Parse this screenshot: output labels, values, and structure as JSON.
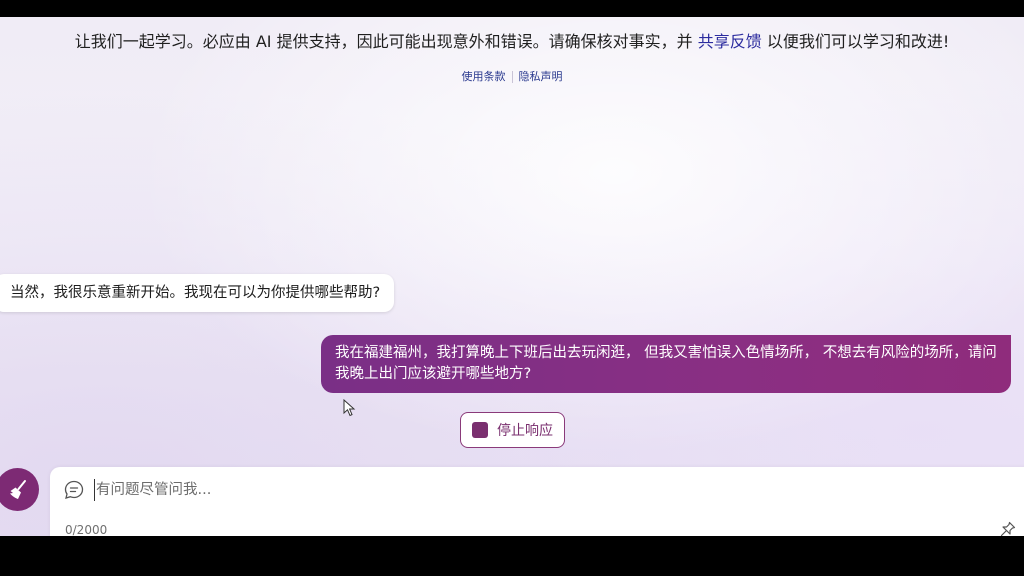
{
  "disclaimer": {
    "text_before": "让我们一起学习。必应由 AI 提供支持，因此可能出现意外和错误。请确保核对事实，并",
    "feedback_link": "共享反馈",
    "text_after": "以便我们可以学习和改进!"
  },
  "legal_links": {
    "terms": "使用条款",
    "privacy": "隐私声明"
  },
  "conversation": {
    "bot_message": "当然，我很乐意重新开始。我现在可以为你提供哪些帮助?",
    "user_message": "我在福建福州，我打算晚上下班后出去玩闲逛， 但我又害怕误入色情场所， 不想去有风险的场所，请问我晚上出门应该避开哪些地方?"
  },
  "stop_button": {
    "label": "停止响应"
  },
  "composer": {
    "placeholder": "有问题尽管问我...",
    "char_count": "0/2000"
  },
  "icons": {
    "new_topic": "broom-icon",
    "chat": "chat-bubble-icon",
    "pin": "pin-icon",
    "stop": "stop-square-icon"
  },
  "colors": {
    "accent": "#7d2a74",
    "user_bubble": "#8a2f83",
    "link": "#2c2c9f"
  }
}
